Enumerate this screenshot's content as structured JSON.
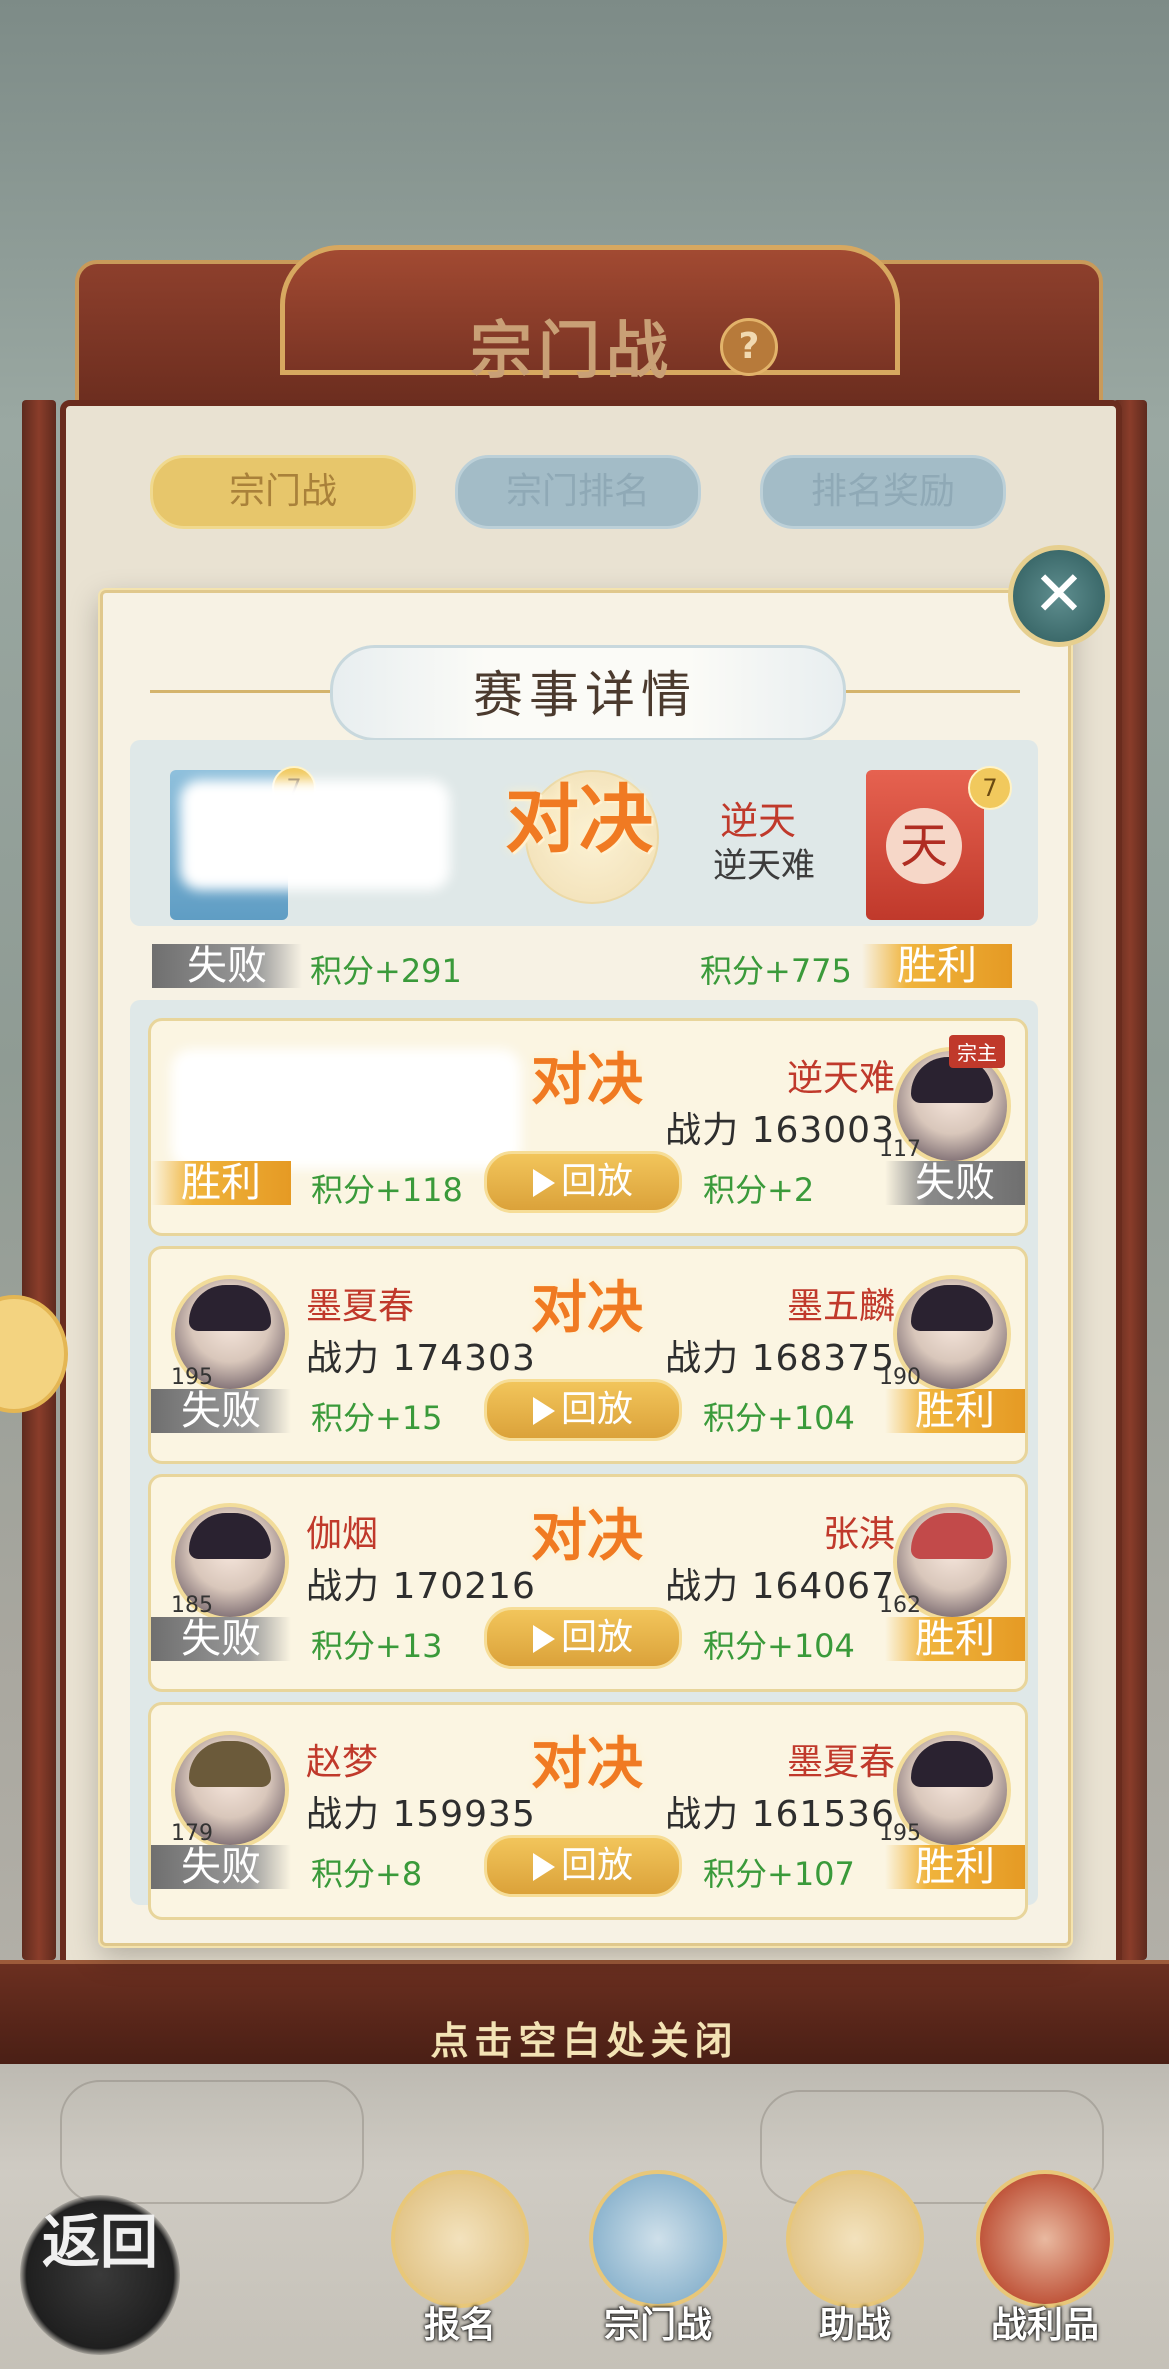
{
  "header": {
    "title": "宗门战",
    "help_icon": "question-mark-icon",
    "tabs": [
      "宗门战",
      "宗门排名",
      "排名奖励"
    ],
    "active_tab": "宗门战"
  },
  "modal": {
    "title": "赛事详情",
    "close_icon": "close-x-icon",
    "summary": {
      "left_guild": {
        "level": "7",
        "result": "失败",
        "score": "积分+291"
      },
      "vs": "对决",
      "right_guild": {
        "name": "逆天",
        "leader": "逆天难",
        "emblem": "天",
        "level": "7",
        "result": "胜利",
        "score": "积分+775"
      }
    },
    "matches": [
      {
        "left": {
          "name": "",
          "power": "",
          "level": "",
          "result": "胜利",
          "score": "积分+118"
        },
        "vs": "对决",
        "replay": "回放",
        "right": {
          "name": "逆天难",
          "power": "战力 163003",
          "level": "117",
          "result": "失败",
          "score": "积分+2",
          "badge": "宗主"
        }
      },
      {
        "left": {
          "name": "墨夏春",
          "power": "战力 174303",
          "level": "195",
          "result": "失败",
          "score": "积分+15"
        },
        "vs": "对决",
        "replay": "回放",
        "right": {
          "name": "墨五麟",
          "power": "战力 168375",
          "level": "190",
          "result": "胜利",
          "score": "积分+104"
        }
      },
      {
        "left": {
          "name": "伽烟",
          "power": "战力 170216",
          "level": "185",
          "result": "失败",
          "score": "积分+13"
        },
        "vs": "对决",
        "replay": "回放",
        "right": {
          "name": "张淇",
          "power": "战力 164067",
          "level": "162",
          "result": "胜利",
          "score": "积分+104"
        }
      },
      {
        "left": {
          "name": "赵梦",
          "power": "战力 159935",
          "level": "179",
          "result": "失败",
          "score": "积分+8"
        },
        "vs": "对决",
        "replay": "回放",
        "right": {
          "name": "墨夏春",
          "power": "战力 161536",
          "level": "195",
          "result": "胜利",
          "score": "积分+107"
        }
      }
    ]
  },
  "close_hint": "点击空白处关闭",
  "bottom_nav": {
    "back": "返回",
    "items": [
      {
        "label": "报名",
        "icon": "scroll-brush-icon"
      },
      {
        "label": "宗门战",
        "icon": "flag-mountain-icon"
      },
      {
        "label": "助战",
        "icon": "handshake-icon"
      },
      {
        "label": "战利品",
        "icon": "treasure-chest-icon"
      }
    ]
  },
  "colors": {
    "win": "#e59a24",
    "lose": "#8a8a8a",
    "score_green": "#3a9a3a",
    "name_red": "#c0392b",
    "vs_orange": "#f07a22"
  }
}
